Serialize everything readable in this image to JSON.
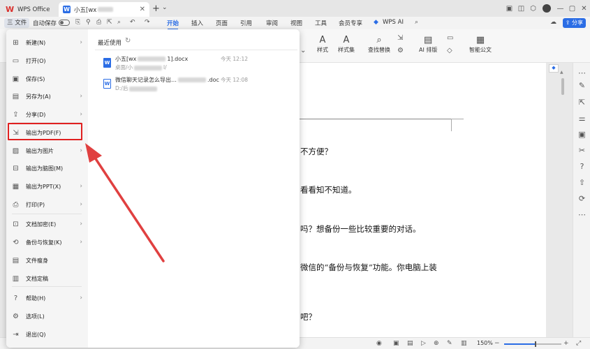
{
  "titlebar": {
    "app_tab": "WPS Office",
    "doc_tab": "小五[wx",
    "doc_tab_suffix": ""
  },
  "menubar": {
    "file": "三 文件",
    "autosave": "自动保存",
    "tabs": [
      "开始",
      "插入",
      "页面",
      "引用",
      "审阅",
      "视图",
      "工具",
      "会员专享"
    ],
    "wps_ai": "WPS AI",
    "share": "分享"
  },
  "toolbar": {
    "style": "样式",
    "style_set": "样式集",
    "find_replace": "查找替换",
    "ai_layout": "AI 排版",
    "smart_doc": "智能公文"
  },
  "file_menu": {
    "items": [
      {
        "label": "新建(N)",
        "icon": "new-doc-icon",
        "arrow": true
      },
      {
        "label": "打开(O)",
        "icon": "open-folder-icon",
        "arrow": false
      },
      {
        "label": "保存(S)",
        "icon": "save-icon",
        "arrow": false
      },
      {
        "label": "另存为(A)",
        "icon": "save-as-icon",
        "arrow": true
      },
      {
        "label": "分享(D)",
        "icon": "share-icon",
        "arrow": true
      },
      {
        "label": "输出为PDF(F)",
        "icon": "pdf-export-icon",
        "arrow": false
      },
      {
        "label": "输出为图片",
        "icon": "image-export-icon",
        "arrow": true
      },
      {
        "label": "输出为脑图(M)",
        "icon": "mindmap-export-icon",
        "arrow": false
      },
      {
        "label": "输出为PPT(X)",
        "icon": "ppt-export-icon",
        "arrow": true
      },
      {
        "label": "打印(P)",
        "icon": "print-icon",
        "arrow": true
      },
      {
        "label": "文档加密(E)",
        "icon": "encrypt-icon",
        "arrow": true
      },
      {
        "label": "备份与恢复(K)",
        "icon": "backup-icon",
        "arrow": true
      },
      {
        "label": "文件瘦身",
        "icon": "slim-icon",
        "arrow": false
      },
      {
        "label": "文档定稿",
        "icon": "finalize-icon",
        "arrow": false
      },
      {
        "label": "帮助(H)",
        "icon": "help-icon",
        "arrow": true
      },
      {
        "label": "选项(L)",
        "icon": "options-icon",
        "arrow": false
      },
      {
        "label": "退出(Q)",
        "icon": "exit-icon",
        "arrow": false
      }
    ],
    "recent_title": "最近使用",
    "recent_files": [
      {
        "name_start": "小五[wx",
        "name_end": "1].docx",
        "path_start": "桌面/小",
        "path_end": "l/",
        "time": "今天 12:12"
      },
      {
        "name_start": "微信聊天记录怎么导出…",
        "name_end": ".doc",
        "path_start": "D:/后",
        "path_end": "",
        "time": "今天 12:08"
      }
    ]
  },
  "document": {
    "lines": [
      "不方便？",
      "看看知不知道。",
      "吗？想备份一些比较重要的对话。",
      "微信的“备份与恢复”功能。你电脑上装",
      "吧？"
    ]
  },
  "statusbar": {
    "zoom": "150%",
    "zoom_level": 0.55
  },
  "colors": {
    "accent": "#2b6de5",
    "highlight": "#e02020",
    "wps_red": "#d9322e"
  }
}
